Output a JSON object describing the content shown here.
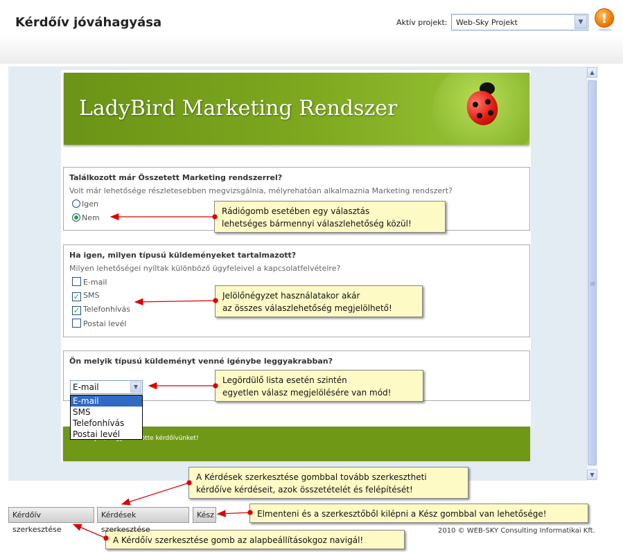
{
  "header": {
    "page_title": "Kérdőív jóváhagyása",
    "project_label": "Aktív projekt:",
    "project_value": "Web-Sky Projekt",
    "alert_glyph": "!"
  },
  "banner": {
    "title": "LadyBird Marketing Rendszer"
  },
  "questions": [
    {
      "title": "Találkozott már Összetett Marketing rendszerrel?",
      "description": "Volt már lehetősége részletesebben megvizsgálnia, mélyrehatóan alkalmaznia Marketing rendszert?",
      "options": [
        {
          "label": "Igen",
          "selected": false
        },
        {
          "label": "Nem",
          "selected": true
        }
      ]
    },
    {
      "title": "Ha igen, milyen típusú küldeményeket tartalmazott?",
      "description": "Milyen lehetőségei nyíltak különböző ügyfeleivel a kapcsolatfelvételre?",
      "options": [
        {
          "label": "E-mail",
          "checked": false
        },
        {
          "label": "SMS",
          "checked": true
        },
        {
          "label": "Telefonhívás",
          "checked": true
        },
        {
          "label": "Postai levél",
          "checked": false
        }
      ]
    },
    {
      "title": "Ön melyik típusú küldeményt venné igénybe leggyakrabban?",
      "dropdown_value": "E-mail",
      "dropdown_options": [
        "E-mail",
        "SMS",
        "Telefonhívás",
        "Postai levél"
      ]
    }
  ],
  "thank_you": "Köszönjük, hogy kitöltötte kérdőívünket!",
  "callouts": {
    "radio": [
      "Rádiógomb esetében egy választás",
      "lehetséges bármennyi válaszlehetőség közül!"
    ],
    "checkbox": [
      "Jelölőnégyzet használatakor akár",
      "az összes válaszlehetőség megjelölhető!"
    ],
    "dropdown": [
      "Legördülő lista esetén szintén",
      "egyetlen válasz megjelölésére van mód!"
    ],
    "questions_button": [
      "A Kérdések szerkesztése gombbal tovább szerkesztheti",
      "kérdőíve kérdéseit, azok összetételét és felépítését!"
    ],
    "done_button": "Elmenteni és a szerkesztőből kilépni a Kész gombbal van lehetősége!",
    "survey_button": "A Kérdőív szerkesztése gomb az alapbeállításokgoz navigál!"
  },
  "buttons": {
    "survey_edit": "Kérdőív szerkesztése",
    "questions_edit": "Kérdések szerkesztése",
    "done": "Kész"
  },
  "copyright": "2010 © WEB-SKY Consulting Informatikai Kft.",
  "colors": {
    "banner_green": "#7fa91f",
    "callout_bg": "#fdfac5",
    "arrow_red": "#dd0000",
    "selected_blue": "#316ac5"
  }
}
